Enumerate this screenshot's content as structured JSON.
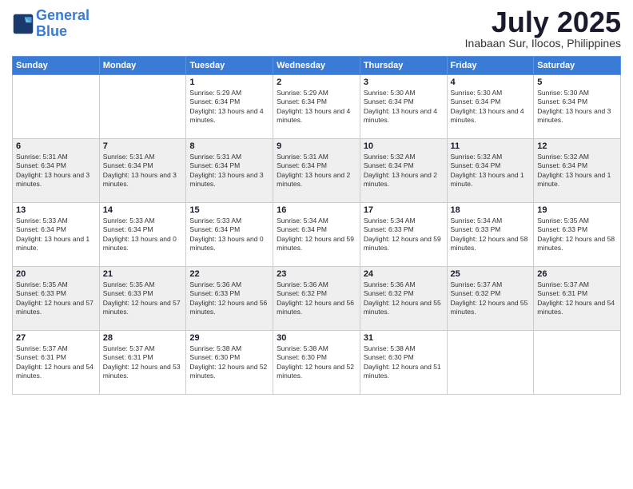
{
  "header": {
    "logo_line1": "General",
    "logo_line2": "Blue",
    "month": "July 2025",
    "location": "Inabaan Sur, Ilocos, Philippines"
  },
  "days_header": [
    "Sunday",
    "Monday",
    "Tuesday",
    "Wednesday",
    "Thursday",
    "Friday",
    "Saturday"
  ],
  "rows": [
    [
      {
        "day": "",
        "info": ""
      },
      {
        "day": "",
        "info": ""
      },
      {
        "day": "1",
        "info": "Sunrise: 5:29 AM\nSunset: 6:34 PM\nDaylight: 13 hours and 4 minutes."
      },
      {
        "day": "2",
        "info": "Sunrise: 5:29 AM\nSunset: 6:34 PM\nDaylight: 13 hours and 4 minutes."
      },
      {
        "day": "3",
        "info": "Sunrise: 5:30 AM\nSunset: 6:34 PM\nDaylight: 13 hours and 4 minutes."
      },
      {
        "day": "4",
        "info": "Sunrise: 5:30 AM\nSunset: 6:34 PM\nDaylight: 13 hours and 4 minutes."
      },
      {
        "day": "5",
        "info": "Sunrise: 5:30 AM\nSunset: 6:34 PM\nDaylight: 13 hours and 3 minutes."
      }
    ],
    [
      {
        "day": "6",
        "info": "Sunrise: 5:31 AM\nSunset: 6:34 PM\nDaylight: 13 hours and 3 minutes."
      },
      {
        "day": "7",
        "info": "Sunrise: 5:31 AM\nSunset: 6:34 PM\nDaylight: 13 hours and 3 minutes."
      },
      {
        "day": "8",
        "info": "Sunrise: 5:31 AM\nSunset: 6:34 PM\nDaylight: 13 hours and 3 minutes."
      },
      {
        "day": "9",
        "info": "Sunrise: 5:31 AM\nSunset: 6:34 PM\nDaylight: 13 hours and 2 minutes."
      },
      {
        "day": "10",
        "info": "Sunrise: 5:32 AM\nSunset: 6:34 PM\nDaylight: 13 hours and 2 minutes."
      },
      {
        "day": "11",
        "info": "Sunrise: 5:32 AM\nSunset: 6:34 PM\nDaylight: 13 hours and 1 minute."
      },
      {
        "day": "12",
        "info": "Sunrise: 5:32 AM\nSunset: 6:34 PM\nDaylight: 13 hours and 1 minute."
      }
    ],
    [
      {
        "day": "13",
        "info": "Sunrise: 5:33 AM\nSunset: 6:34 PM\nDaylight: 13 hours and 1 minute."
      },
      {
        "day": "14",
        "info": "Sunrise: 5:33 AM\nSunset: 6:34 PM\nDaylight: 13 hours and 0 minutes."
      },
      {
        "day": "15",
        "info": "Sunrise: 5:33 AM\nSunset: 6:34 PM\nDaylight: 13 hours and 0 minutes."
      },
      {
        "day": "16",
        "info": "Sunrise: 5:34 AM\nSunset: 6:34 PM\nDaylight: 12 hours and 59 minutes."
      },
      {
        "day": "17",
        "info": "Sunrise: 5:34 AM\nSunset: 6:33 PM\nDaylight: 12 hours and 59 minutes."
      },
      {
        "day": "18",
        "info": "Sunrise: 5:34 AM\nSunset: 6:33 PM\nDaylight: 12 hours and 58 minutes."
      },
      {
        "day": "19",
        "info": "Sunrise: 5:35 AM\nSunset: 6:33 PM\nDaylight: 12 hours and 58 minutes."
      }
    ],
    [
      {
        "day": "20",
        "info": "Sunrise: 5:35 AM\nSunset: 6:33 PM\nDaylight: 12 hours and 57 minutes."
      },
      {
        "day": "21",
        "info": "Sunrise: 5:35 AM\nSunset: 6:33 PM\nDaylight: 12 hours and 57 minutes."
      },
      {
        "day": "22",
        "info": "Sunrise: 5:36 AM\nSunset: 6:33 PM\nDaylight: 12 hours and 56 minutes."
      },
      {
        "day": "23",
        "info": "Sunrise: 5:36 AM\nSunset: 6:32 PM\nDaylight: 12 hours and 56 minutes."
      },
      {
        "day": "24",
        "info": "Sunrise: 5:36 AM\nSunset: 6:32 PM\nDaylight: 12 hours and 55 minutes."
      },
      {
        "day": "25",
        "info": "Sunrise: 5:37 AM\nSunset: 6:32 PM\nDaylight: 12 hours and 55 minutes."
      },
      {
        "day": "26",
        "info": "Sunrise: 5:37 AM\nSunset: 6:31 PM\nDaylight: 12 hours and 54 minutes."
      }
    ],
    [
      {
        "day": "27",
        "info": "Sunrise: 5:37 AM\nSunset: 6:31 PM\nDaylight: 12 hours and 54 minutes."
      },
      {
        "day": "28",
        "info": "Sunrise: 5:37 AM\nSunset: 6:31 PM\nDaylight: 12 hours and 53 minutes."
      },
      {
        "day": "29",
        "info": "Sunrise: 5:38 AM\nSunset: 6:30 PM\nDaylight: 12 hours and 52 minutes."
      },
      {
        "day": "30",
        "info": "Sunrise: 5:38 AM\nSunset: 6:30 PM\nDaylight: 12 hours and 52 minutes."
      },
      {
        "day": "31",
        "info": "Sunrise: 5:38 AM\nSunset: 6:30 PM\nDaylight: 12 hours and 51 minutes."
      },
      {
        "day": "",
        "info": ""
      },
      {
        "day": "",
        "info": ""
      }
    ]
  ]
}
